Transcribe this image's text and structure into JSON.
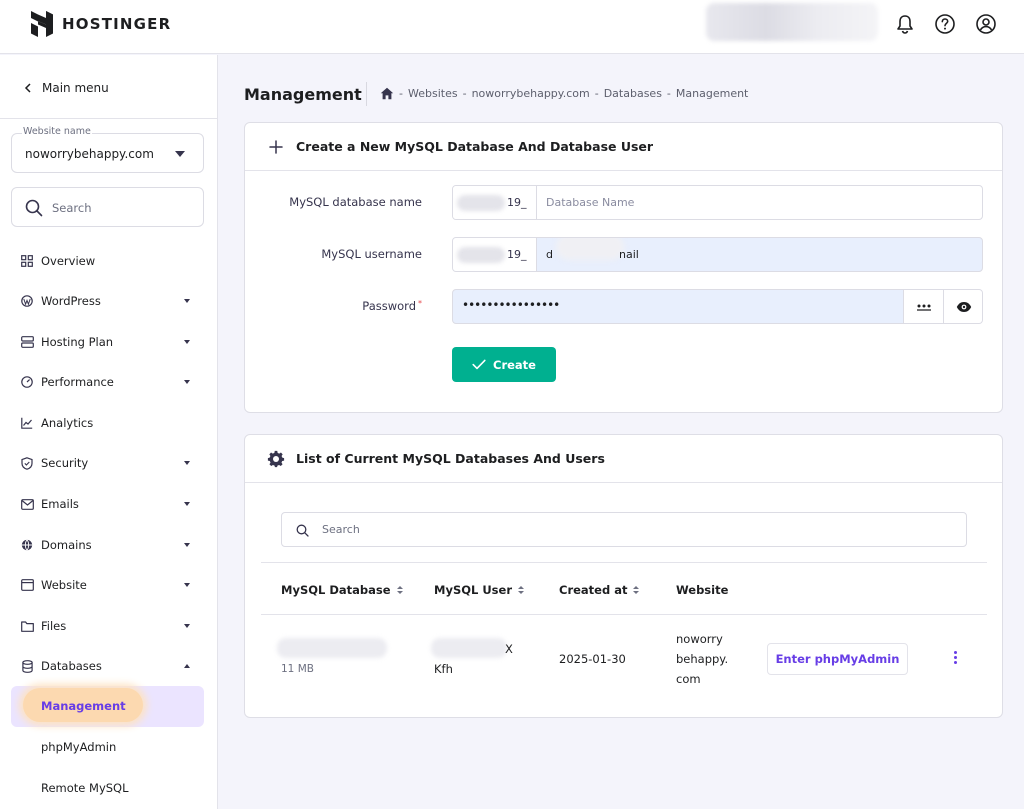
{
  "header": {
    "brand": "HOSTINGER",
    "icons": [
      "bell-icon",
      "help-icon",
      "account-icon"
    ]
  },
  "sidebar": {
    "main_menu": "Main menu",
    "website_label": "Website name",
    "website_value": "noworrybehappy.com",
    "search_placeholder": "Search",
    "items": [
      {
        "label": "Overview",
        "icon": "grid-icon",
        "expandable": false
      },
      {
        "label": "WordPress",
        "icon": "wordpress-icon",
        "expandable": true
      },
      {
        "label": "Hosting Plan",
        "icon": "server-icon",
        "expandable": true
      },
      {
        "label": "Performance",
        "icon": "gauge-icon",
        "expandable": true
      },
      {
        "label": "Analytics",
        "icon": "chart-line-icon",
        "expandable": false
      },
      {
        "label": "Security",
        "icon": "shield-icon",
        "expandable": true
      },
      {
        "label": "Emails",
        "icon": "mail-icon",
        "expandable": true
      },
      {
        "label": "Domains",
        "icon": "globe-icon",
        "expandable": true
      },
      {
        "label": "Website",
        "icon": "browser-icon",
        "expandable": true
      },
      {
        "label": "Files",
        "icon": "folder-icon",
        "expandable": true
      },
      {
        "label": "Databases",
        "icon": "database-icon",
        "expandable": true
      }
    ],
    "subitems": [
      "Management",
      "phpMyAdmin",
      "Remote MySQL"
    ],
    "active_subitem": "Management"
  },
  "page": {
    "title": "Management",
    "breadcrumb": [
      "Websites",
      "noworrybehappy.com",
      "Databases",
      "Management"
    ],
    "breadcrumb_sep": "-"
  },
  "create_card": {
    "title": "Create a New MySQL Database And Database User",
    "db_name_label": "MySQL database name",
    "db_prefix_suffix": "19_",
    "db_name_placeholder": "Database Name",
    "username_label": "MySQL username",
    "username_prefix_suffix": "19_",
    "username_prefix_lead": "u",
    "username_value_start": "d",
    "username_value_end": "nail",
    "password_label": "Password",
    "password_required_mark": "*",
    "password_value": "••••••••••••••••",
    "create_label": "Create"
  },
  "list_card": {
    "title": "List of Current MySQL Databases And Users",
    "search_placeholder": "Search",
    "columns": [
      "MySQL Database",
      "MySQL User",
      "Created at",
      "Website"
    ],
    "row": {
      "db_size": "11 MB",
      "user_tail": "X",
      "user_line2": "Kfh",
      "created_at": "2025-01-30",
      "website_lines": [
        "noworry",
        "behappy.",
        "com"
      ],
      "action_label": "Enter phpMyAdmin"
    }
  },
  "colors": {
    "accent": "#673de6",
    "create_button": "#00b090",
    "active_sub_bg": "#ebe4ff",
    "highlight": "#fcd9b0"
  }
}
